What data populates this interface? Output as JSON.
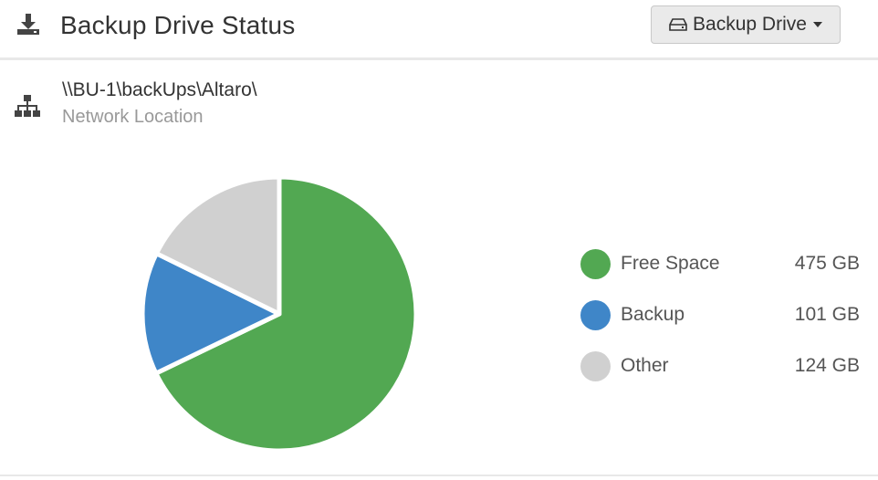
{
  "header": {
    "title": "Backup Drive Status",
    "icon": "download-icon",
    "drive_button_label": "Backup Drive"
  },
  "location": {
    "icon": "network-icon",
    "path": "\\\\BU-1\\backUps\\Altaro\\",
    "type_label": "Network Location"
  },
  "colors": {
    "free": "#52a852",
    "backup": "#3f86c8",
    "other": "#d0d0d0"
  },
  "chart_data": {
    "type": "pie",
    "slices": [
      {
        "name": "Free Space",
        "value": 475,
        "unit": "GB",
        "color": "#52a852"
      },
      {
        "name": "Backup",
        "value": 101,
        "unit": "GB",
        "color": "#3f86c8"
      },
      {
        "name": "Other",
        "value": 124,
        "unit": "GB",
        "color": "#d0d0d0"
      }
    ],
    "legend": {
      "placement": "right",
      "items": [
        {
          "label": "Free Space",
          "value": "475 GB"
        },
        {
          "label": "Backup",
          "value": "101 GB"
        },
        {
          "label": "Other",
          "value": "124 GB"
        }
      ]
    }
  }
}
